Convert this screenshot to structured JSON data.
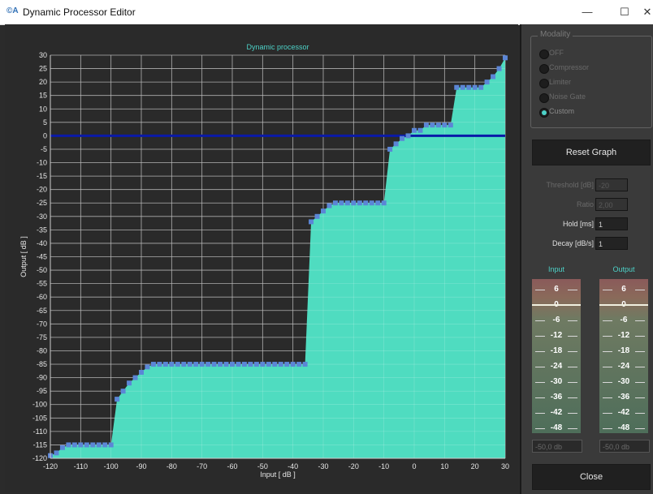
{
  "window": {
    "icon_text": "©A",
    "title": "Dynamic Processor Editor",
    "minimize": "—",
    "maximize": "☐",
    "close": "✕"
  },
  "chart_data": {
    "type": "area",
    "title": "Dynamic processor",
    "xlabel": "Input [ dB ]",
    "ylabel": "Output [ dB ]",
    "xlim": [
      -120,
      30
    ],
    "ylim": [
      -120,
      30
    ],
    "x_ticks": [
      -120,
      -110,
      -100,
      -90,
      -80,
      -70,
      -60,
      -50,
      -40,
      -30,
      -20,
      -10,
      0,
      10,
      20,
      30
    ],
    "y_ticks": [
      30,
      25,
      20,
      15,
      10,
      5,
      0,
      -5,
      -10,
      -15,
      -20,
      -25,
      -30,
      -35,
      -40,
      -45,
      -50,
      -55,
      -60,
      -65,
      -70,
      -75,
      -80,
      -85,
      -90,
      -95,
      -100,
      -105,
      -110,
      -115,
      -120
    ],
    "grid": true,
    "reference_line_y": 0,
    "fill_color": "#4fdcc0",
    "marker_color": "#5b86d6",
    "series": [
      {
        "x": [
          -120,
          -118,
          -116,
          -114,
          -112,
          -110,
          -108,
          -106,
          -104,
          -102,
          -100,
          -98,
          -96,
          -94,
          -92,
          -90,
          -88,
          -86,
          -84,
          -82,
          -80,
          -78,
          -76,
          -74,
          -72,
          -70,
          -68,
          -66,
          -64,
          -62,
          -60,
          -58,
          -56,
          -54,
          -52,
          -50,
          -48,
          -46,
          -44,
          -42,
          -40,
          -38,
          -36,
          -34,
          -32,
          -30,
          -28,
          -26,
          -24,
          -22,
          -20,
          -18,
          -16,
          -14,
          -12,
          -10,
          -8,
          -6,
          -4,
          -2,
          0,
          2,
          4,
          6,
          8,
          10,
          12,
          14,
          16,
          18,
          20,
          22,
          24,
          26,
          28,
          30
        ],
        "y": [
          -119,
          -118,
          -116,
          -115,
          -115,
          -115,
          -115,
          -115,
          -115,
          -115,
          -115,
          -98,
          -95,
          -92,
          -90,
          -88,
          -86,
          -85,
          -85,
          -85,
          -85,
          -85,
          -85,
          -85,
          -85,
          -85,
          -85,
          -85,
          -85,
          -85,
          -85,
          -85,
          -85,
          -85,
          -85,
          -85,
          -85,
          -85,
          -85,
          -85,
          -85,
          -85,
          -85,
          -32,
          -30,
          -28,
          -26,
          -25,
          -25,
          -25,
          -25,
          -25,
          -25,
          -25,
          -25,
          -25,
          -5,
          -3,
          -1,
          0,
          2,
          2,
          4,
          4,
          4,
          4,
          4,
          18,
          18,
          18,
          18,
          18,
          20,
          22,
          25,
          29
        ]
      }
    ]
  },
  "panel": {
    "modality_title": "Modality",
    "modes": [
      {
        "label": "OFF",
        "selected": false
      },
      {
        "label": "Compressor",
        "selected": false
      },
      {
        "label": "Limiter",
        "selected": false
      },
      {
        "label": "Noise Gate",
        "selected": false
      },
      {
        "label": "Custom",
        "selected": true
      }
    ],
    "reset_label": "Reset Graph",
    "params": [
      {
        "label": "Threshold [dB]",
        "value": "-20",
        "enabled": false
      },
      {
        "label": "Ratio",
        "value": "2,00",
        "enabled": false
      },
      {
        "label": "Hold [ms]",
        "value": "1",
        "enabled": true
      },
      {
        "label": "Decay [dB/s]",
        "value": "1",
        "enabled": true
      }
    ],
    "input_meter_title": "Input",
    "output_meter_title": "Output",
    "meter_ticks": [
      "6",
      "0",
      "-6",
      "-12",
      "-18",
      "-24",
      "-30",
      "-36",
      "-42",
      "-48"
    ],
    "input_level": "-50,0 db",
    "output_level": "-50,0 db",
    "close_label": "Close"
  }
}
